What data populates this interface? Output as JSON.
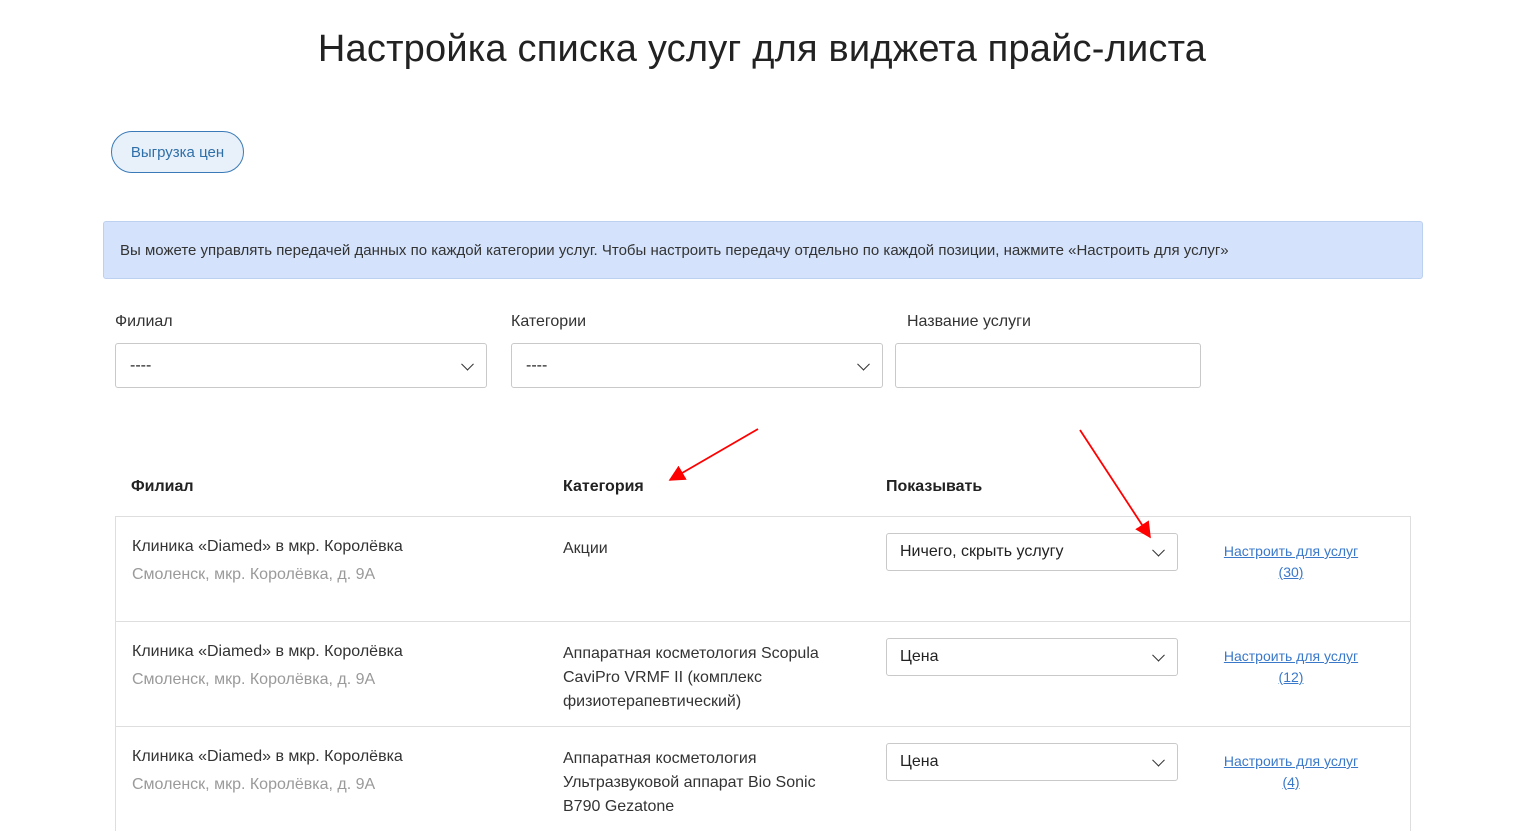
{
  "page": {
    "title": "Настройка списка услуг для виджета прайс-листа",
    "export_button": "Выгрузка цен",
    "info_text": "Вы можете управлять передачей данных по каждой категории услуг. Чтобы настроить передачу отдельно по каждой позиции, нажмите «Настроить для услуг»"
  },
  "filters": {
    "branch_label": "Филиал",
    "branch_value": "----",
    "category_label": "Категории",
    "category_value": "----",
    "service_label": "Название услуги",
    "service_value": ""
  },
  "table": {
    "headers": {
      "branch": "Филиал",
      "category": "Категория",
      "show": "Показывать"
    },
    "rows": [
      {
        "branch_name": "Клиника «Diamed» в мкр. Королёвка",
        "branch_address": "Смоленск, мкр. Королёвка, д. 9А",
        "category": "Акции",
        "show": "Ничего, скрыть услугу",
        "link_label": "Настроить для услуг",
        "link_count": "(30)"
      },
      {
        "branch_name": "Клиника «Diamed» в мкр. Королёвка",
        "branch_address": "Смоленск, мкр. Королёвка, д. 9А",
        "category": "Аппаратная косметология Scopula CaviPro VRMF II (комплекс физиотерапевтический)",
        "show": "Цена",
        "link_label": "Настроить для услуг",
        "link_count": "(12)"
      },
      {
        "branch_name": "Клиника «Diamed» в мкр. Королёвка",
        "branch_address": "Смоленск, мкр. Королёвка, д. 9А",
        "category": "Аппаратная косметология Ультразвуковой аппарат Bio Sonic B790 Gezatone",
        "show": "Цена",
        "link_label": "Настроить для услуг",
        "link_count": "(4)"
      }
    ]
  },
  "annotation_color": "#ff0000"
}
